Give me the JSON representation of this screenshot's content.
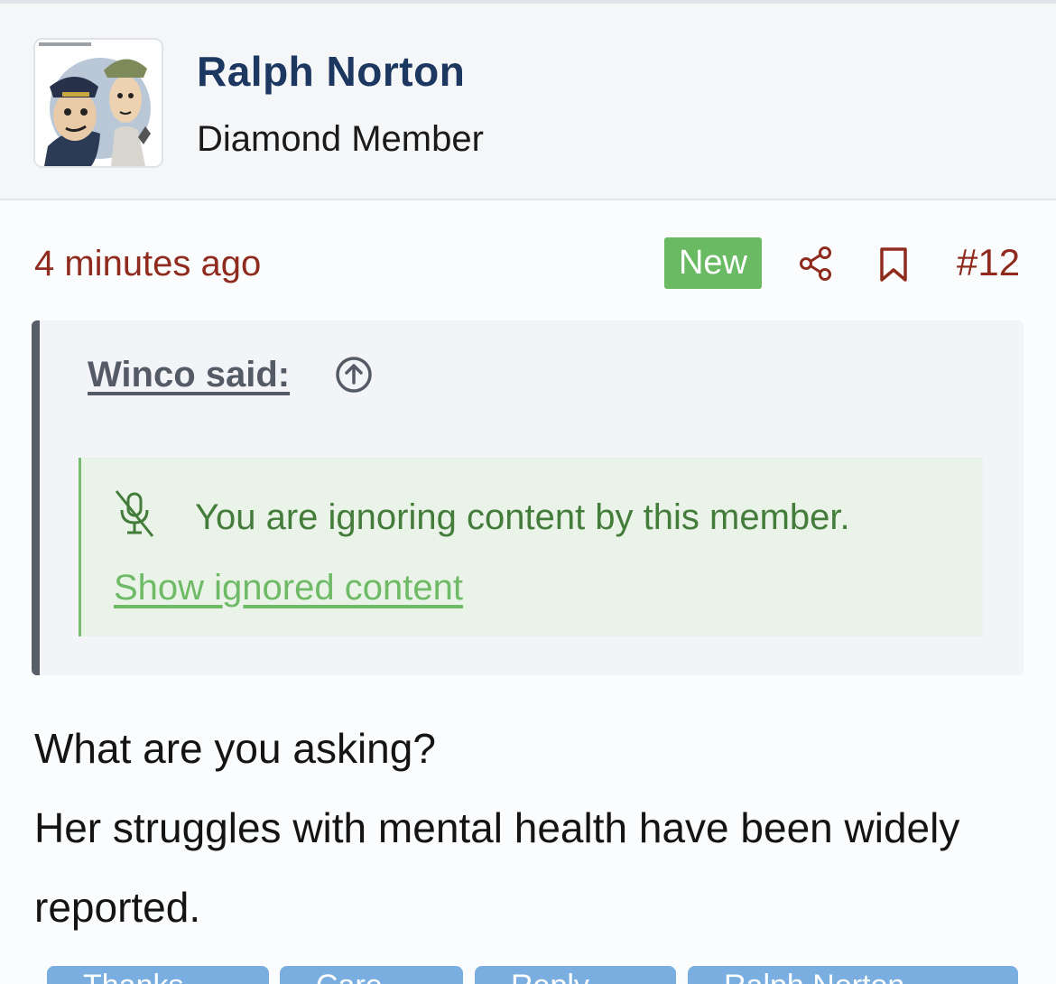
{
  "poster": {
    "name": "Ralph Norton",
    "title": "Diamond Member",
    "avatar_icon": "cartoon-caricature-avatar"
  },
  "post": {
    "time": "4 minutes ago",
    "badge": "New",
    "number": "#12"
  },
  "quote": {
    "author": "Winco said:",
    "ignored_message": "You are ignoring content by this member.",
    "show_ignored_label": "Show ignored content"
  },
  "body": {
    "lines": [
      "What are you asking?",
      "Her struggles with mental health have been widely reported."
    ]
  },
  "reactions": {
    "buttons": [
      {
        "label": "Thanks",
        "icon": "thumbs-up-icon"
      },
      {
        "label": "Care",
        "icon": "heart-icon"
      },
      {
        "label": "Reply",
        "icon": "quote-icon"
      },
      {
        "label": "Ralph Norton",
        "icon": "mention-icon"
      }
    ]
  },
  "colors": {
    "username": "#1c3760",
    "timestamp": "#8f2b1e",
    "badge": "#6aba64",
    "ignored_text": "#447c3b",
    "ignored_link": "#6fba66",
    "reaction_button": "#7aaee0"
  }
}
